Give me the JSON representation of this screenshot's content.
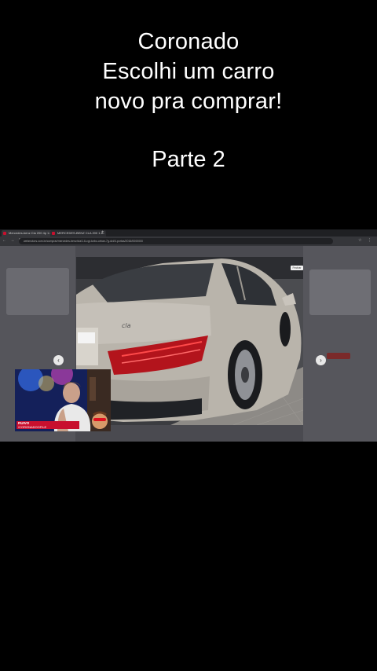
{
  "overlay": {
    "title_lines": [
      "Coronado",
      "Escolhi um carro",
      "novo pra comprar!"
    ],
    "part": "Parte 2"
  },
  "browser": {
    "tabs": [
      {
        "label": "Mercedes-benz Cla 200 4p 1.6"
      },
      {
        "label": "MERCEDES-BENZ CLA 200 1.6"
      }
    ],
    "new_tab": "+",
    "close": "×",
    "nav_icons": "← → ↻",
    "url": "webmotors.com.br/comprar/mercedes-benz/cla/1.6-cgi-turbo-urban-7g-dct/4-portas/2016/0000000",
    "right_icons": "☆ ⋮"
  },
  "gallery": {
    "close_label": "Fechar",
    "prev_icon": "‹",
    "next_icon": "›",
    "thumbnail_count": 6
  },
  "webcam": {
    "label_top": "RUIVO",
    "label_bottom": "/CORONADOOFILE"
  },
  "colors": {
    "background": "#000000",
    "brand_red": "#c8102e",
    "car_silver": "#b9b4ab"
  }
}
